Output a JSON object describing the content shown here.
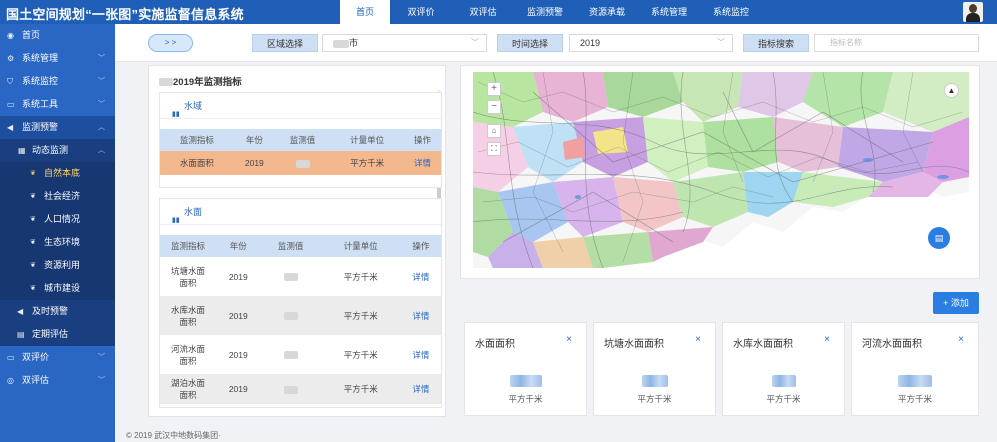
{
  "app": {
    "title": "国土空间规划“一张图”实施监督信息系统"
  },
  "topnav": [
    {
      "label": "首页",
      "active": true
    },
    {
      "label": "双评价",
      "active": false
    },
    {
      "label": "双评估",
      "active": false
    },
    {
      "label": "监测预警",
      "active": false
    },
    {
      "label": "资源承载",
      "active": false
    },
    {
      "label": "系统管理",
      "active": false
    },
    {
      "label": "系统监控",
      "active": false
    }
  ],
  "sidebar": {
    "items": [
      {
        "label": "首页",
        "icon": "dashboard-icon"
      },
      {
        "label": "系统管理",
        "icon": "gear-icon"
      },
      {
        "label": "系统监控",
        "icon": "shield-icon"
      },
      {
        "label": "系统工具",
        "icon": "toolbox-icon"
      },
      {
        "label": "监测预警",
        "icon": "speaker-icon"
      },
      {
        "label": "动态监测",
        "icon": "grid-icon"
      },
      {
        "label": "自然本底",
        "icon": "leaf-icon"
      },
      {
        "label": "社会经济",
        "icon": "chart-icon"
      },
      {
        "label": "人口情况",
        "icon": "person-icon"
      },
      {
        "label": "生态环境",
        "icon": "leaf-icon"
      },
      {
        "label": "资源利用",
        "icon": "resource-icon"
      },
      {
        "label": "城市建设",
        "icon": "building-icon"
      },
      {
        "label": "及时预警",
        "icon": "speaker-icon"
      },
      {
        "label": "定期评估",
        "icon": "document-icon"
      },
      {
        "label": "双评价",
        "icon": "folder-icon"
      },
      {
        "label": "双评估",
        "icon": "globe-icon"
      }
    ]
  },
  "filters": {
    "expand_label": "> >",
    "region_label": "区域选择",
    "region_value": "市",
    "time_label": "时间选择",
    "time_value": "2019",
    "indicator_label": "指标搜索",
    "indicator_placeholder": "指标名称"
  },
  "indicators": {
    "title": "2019年监测指标",
    "columns": [
      "监测指标",
      "年份",
      "监测值",
      "计量单位",
      "操作"
    ],
    "sections": [
      {
        "name": "水域",
        "rows": [
          {
            "name": "水面面积",
            "year": "2019",
            "unit": "平方千米",
            "action": "详情"
          }
        ]
      },
      {
        "name": "水面",
        "rows": [
          {
            "name": "坑塘水面面积",
            "year": "2019",
            "unit": "平方千米",
            "action": "详情"
          },
          {
            "name": "水库水面面积",
            "year": "2019",
            "unit": "平方千米",
            "action": "详情"
          },
          {
            "name": "河流水面面积",
            "year": "2019",
            "unit": "平方千米",
            "action": "详情"
          },
          {
            "name": "湖泊水面面积",
            "year": "2019",
            "unit": "平方千米",
            "action": "详情"
          }
        ]
      }
    ]
  },
  "add_button": "+ 添加",
  "metric_cards": [
    {
      "title": "水面面积",
      "unit": "平方千米"
    },
    {
      "title": "坑塘水面面积",
      "unit": "平方千米"
    },
    {
      "title": "水库水面面积",
      "unit": "平方千米"
    },
    {
      "title": "河流水面面积",
      "unit": "平方千米"
    }
  ],
  "footer": "© 2019 武汉中地数码集团·",
  "colors": {
    "brand": "#1f5fb8",
    "sidebar": "#2a66c4",
    "highlight_row": "#f4b88f",
    "accent": "#2a7de1"
  }
}
